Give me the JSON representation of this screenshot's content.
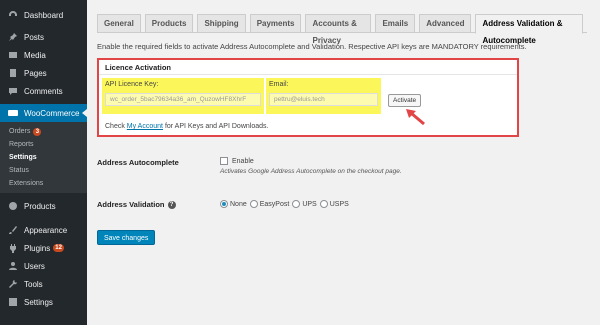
{
  "sidebar": {
    "items": [
      {
        "label": "Dashboard",
        "icon": "dashboard-icon"
      },
      {
        "label": "Posts",
        "icon": "pin-icon"
      },
      {
        "label": "Media",
        "icon": "media-icon"
      },
      {
        "label": "Pages",
        "icon": "pages-icon"
      },
      {
        "label": "Comments",
        "icon": "comment-icon"
      },
      {
        "label": "WooCommerce",
        "icon": "woocommerce-icon"
      }
    ],
    "submenu": [
      {
        "label": "Orders",
        "badge": "3"
      },
      {
        "label": "Reports"
      },
      {
        "label": "Settings"
      },
      {
        "label": "Status"
      },
      {
        "label": "Extensions"
      }
    ],
    "items_after": [
      {
        "label": "Products",
        "icon": "products-icon"
      },
      {
        "label": "Appearance",
        "icon": "brush-icon"
      },
      {
        "label": "Plugins",
        "icon": "plugin-icon",
        "badge": "12"
      },
      {
        "label": "Users",
        "icon": "users-icon"
      },
      {
        "label": "Tools",
        "icon": "wrench-icon"
      },
      {
        "label": "Settings",
        "icon": "settings-icon"
      }
    ]
  },
  "tabs": [
    "General",
    "Products",
    "Shipping",
    "Payments",
    "Accounts & Privacy",
    "Emails",
    "Advanced",
    "Address Validation & Autocomplete"
  ],
  "intro": "Enable the required fields to activate Address Autocomplete and Validation. Respective API keys are MANDATORY requirements.",
  "licence": {
    "heading": "Licence Activation",
    "api_label": "API Licence Key:",
    "api_value": "wc_order_5bac79634a36_am_QuzowHF8XhrF",
    "email_label": "Email:",
    "email_value": "pettru@eluis.tech",
    "activate_label": "Activate",
    "check_prefix": "Check",
    "check_link": "My Account",
    "check_suffix": "for API Keys and API Downloads."
  },
  "autocomplete": {
    "label": "Address Autocomplete",
    "option": "Enable",
    "description": "Activates Google Address Autocomplete on the checkout page."
  },
  "validation": {
    "label": "Address Validation",
    "options": [
      "None",
      "EasyPost",
      "UPS",
      "USPS"
    ],
    "selected": "None"
  },
  "save_label": "Save changes",
  "colors": {
    "highlight_border": "#e14545",
    "accent": "#0073aa",
    "input_highlight": "#fbf75a"
  }
}
